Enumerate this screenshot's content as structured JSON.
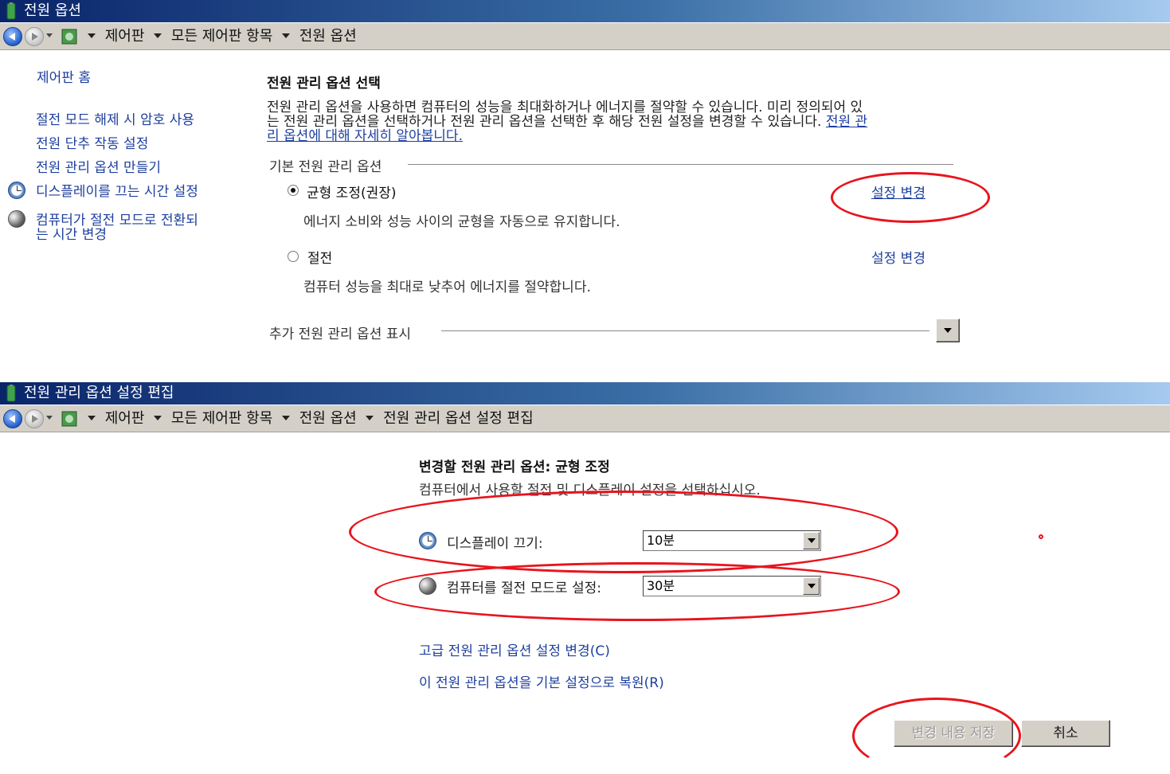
{
  "window1": {
    "title": "전원 옵션",
    "breadcrumbs": [
      "제어판",
      "모든 제어판 항목",
      "전원 옵션"
    ],
    "sidebar": {
      "home": "제어판 홈",
      "items": [
        "절전 모드 해제 시 암호 사용",
        "전원 단추 작동 설정",
        "전원 관리 옵션 만들기",
        "디스플레이를 끄는 시간 설정",
        "컴퓨터가 절전 모드로 전환되",
        "는 시간 변경"
      ]
    },
    "heading": "전원 관리 옵션 선택",
    "description": {
      "line1": "전원 관리 옵션을 사용하면 컴퓨터의 성능을 최대화하거나 에너지를 절약할 수 있습니다. 미리 정의되어 있",
      "line2_text": "는 전원 관리 옵션을 선택하거나 전원 관리 옵션을 선택한 후 해당 전원 설정을 변경할 수 있습니다.",
      "line2_link": "전원 관",
      "line3_link": "리 옵션에 대해 자세히 알아봅니다."
    },
    "group_label": "기본 전원 관리 옵션",
    "plans": [
      {
        "name": "균형 조정(권장)",
        "description": "에너지 소비와 성능 사이의 균형을 자동으로 유지합니다.",
        "change_link": "설정 변경",
        "selected": true
      },
      {
        "name": "절전",
        "description": "컴퓨터 성능을 최대로 낮추어 에너지를 절약합니다.",
        "change_link": "설정 변경",
        "selected": false
      }
    ],
    "more_plans": "추가 전원 관리 옵션 표시"
  },
  "window2": {
    "title": "전원 관리 옵션 설정 편집",
    "breadcrumbs": [
      "제어판",
      "모든 제어판 항목",
      "전원 옵션",
      "전원 관리 옵션 설정 편집"
    ],
    "heading": "변경할 전원 관리 옵션: 균형 조정",
    "subheading": "컴퓨터에서 사용할 절전 및 디스플레이 설정을 선택하십시오.",
    "display_off": {
      "label": "디스플레이 끄기:",
      "value": "10분"
    },
    "sleep": {
      "label": "컴퓨터를 절전 모드로 설정:",
      "value": "30분"
    },
    "advanced_link": "고급 전원 관리 옵션 설정 변경(C)",
    "restore_link": "이 전원 관리 옵션을 기본 설정으로 복원(R)",
    "save_button": "변경 내용 저장",
    "cancel_button": "취소"
  },
  "colors": {
    "annotation": "#e8141d",
    "link": "#1e3f9e"
  }
}
